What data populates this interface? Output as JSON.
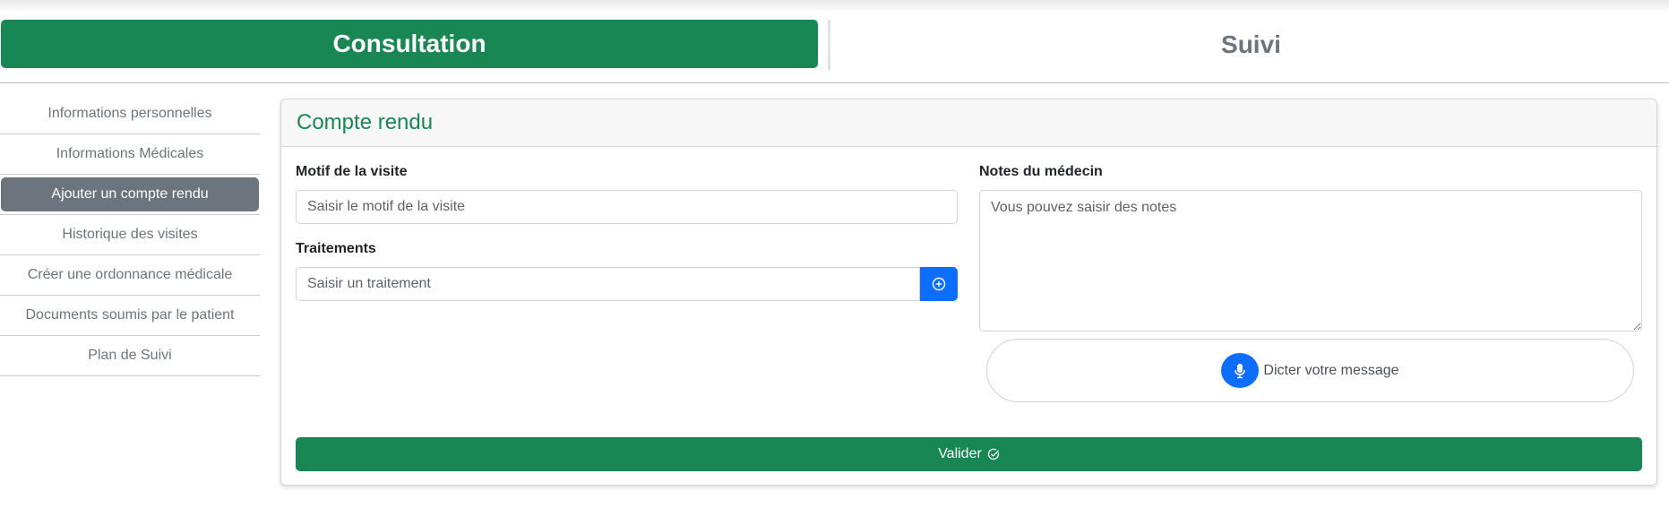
{
  "tabs": {
    "consultation": "Consultation",
    "suivi": "Suivi"
  },
  "sidebar": {
    "items": [
      {
        "label": "Informations personnelles"
      },
      {
        "label": "Informations Médicales"
      },
      {
        "label": "Ajouter un compte rendu",
        "active": true
      },
      {
        "label": "Historique des visites"
      },
      {
        "label": "Créer une ordonnance médicale"
      },
      {
        "label": "Documents soumis par le patient"
      },
      {
        "label": "Plan de Suivi"
      }
    ]
  },
  "form": {
    "title": "Compte rendu",
    "motif_label": "Motif de la visite",
    "motif_placeholder": "Saisir le motif de la visite",
    "traitements_label": "Traitements",
    "traitement_placeholder": "Saisir un traitement",
    "add_icon": "plus-circle-icon",
    "notes_label": "Notes du médecin",
    "notes_placeholder": "Vous pouvez saisir des notes",
    "dictate_label": "Dicter votre message",
    "mic_icon": "microphone-icon",
    "validate_label": "Valider",
    "validate_icon": "check-circle-icon"
  },
  "colors": {
    "primary_green": "#198754",
    "secondary_gray": "#6c757d",
    "accent_blue": "#0d6efd"
  }
}
